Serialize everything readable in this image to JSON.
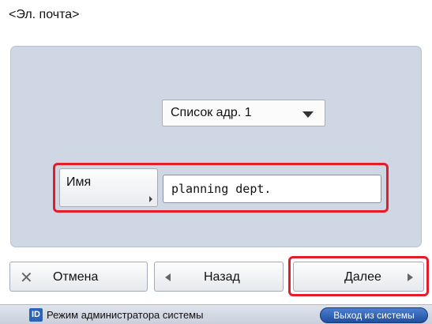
{
  "title": "<Эл. почта>",
  "address_list": {
    "selected": "Список адр. 1"
  },
  "name_field": {
    "button_label": "Имя",
    "value": "planning dept."
  },
  "buttons": {
    "cancel": "Отмена",
    "back": "Назад",
    "next": "Далее"
  },
  "status_bar": {
    "badge": "ID",
    "mode": "Режим администратора системы",
    "logout": "Выход из системы"
  },
  "colors": {
    "panel": "#cfd6e4",
    "highlight": "#e31d2a",
    "logout": "#1f4f9f"
  }
}
